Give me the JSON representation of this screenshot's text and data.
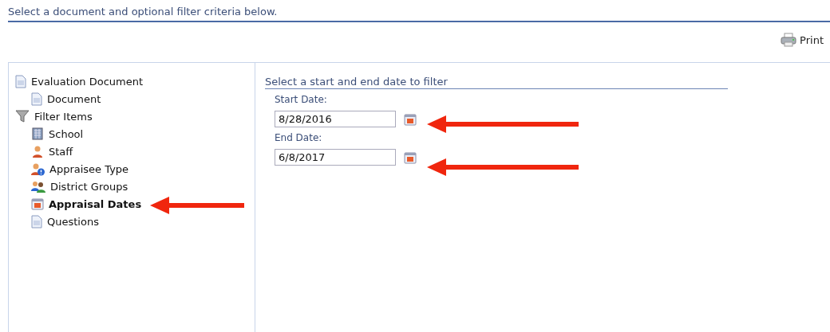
{
  "header": {
    "title": "Select a document and optional filter criteria below."
  },
  "toolbar": {
    "print_label": "Print"
  },
  "tree": [
    {
      "label": "Evaluation Document",
      "kind": "document",
      "selected": false,
      "children": [
        {
          "label": "Document",
          "kind": "document",
          "selected": false
        }
      ]
    },
    {
      "label": "Filter Items",
      "kind": "filter",
      "selected": false,
      "children": [
        {
          "label": "School",
          "kind": "school",
          "selected": false
        },
        {
          "label": "Staff",
          "kind": "staff",
          "selected": false
        },
        {
          "label": "Appraisee Type",
          "kind": "appraisee",
          "selected": false
        },
        {
          "label": "District Groups",
          "kind": "groups",
          "selected": false
        },
        {
          "label": "Appraisal Dates",
          "kind": "calendar",
          "selected": true
        },
        {
          "label": "Questions",
          "kind": "document",
          "selected": false
        }
      ]
    }
  ],
  "filter": {
    "title": "Select a start and end date to filter",
    "fields": [
      {
        "label": "Start Date:",
        "value": "8/28/2016"
      },
      {
        "label": "End Date:",
        "value": "6/8/2017"
      }
    ]
  }
}
